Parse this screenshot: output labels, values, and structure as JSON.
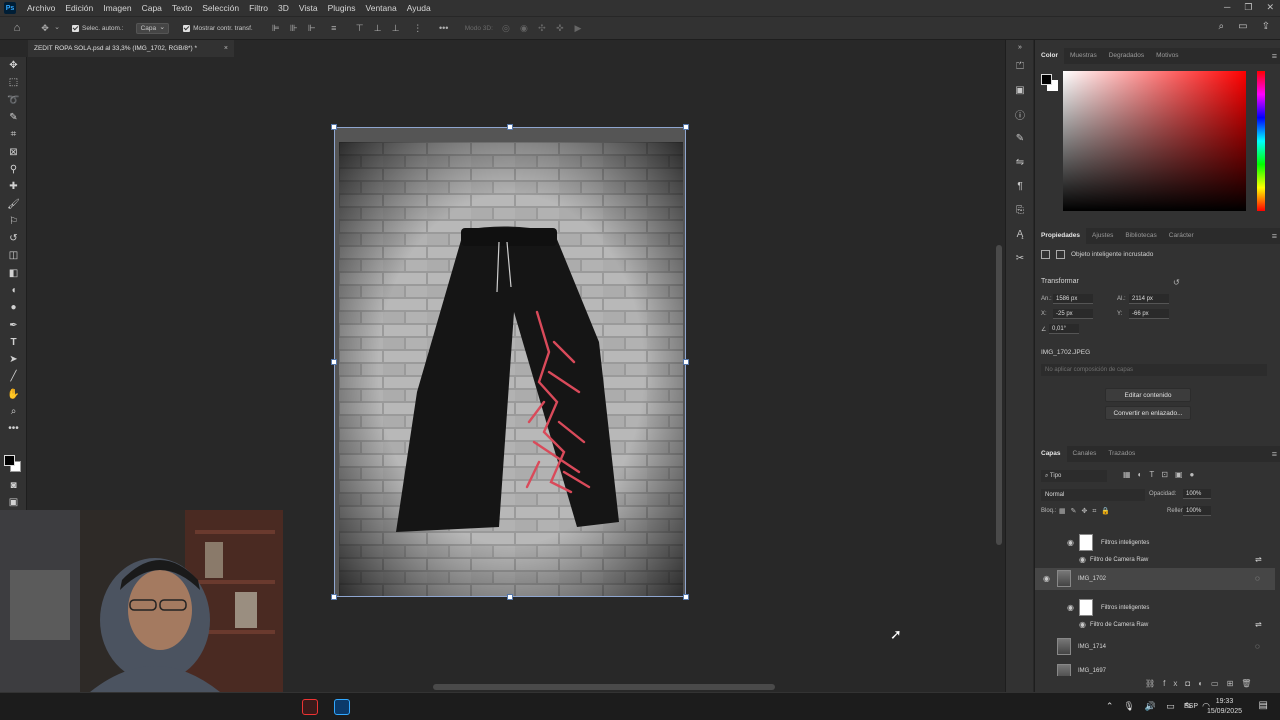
{
  "menu": [
    "Archivo",
    "Edición",
    "Imagen",
    "Capa",
    "Texto",
    "Selección",
    "Filtro",
    "3D",
    "Vista",
    "Plugins",
    "Ventana",
    "Ayuda"
  ],
  "app_logo": "Ps",
  "options": {
    "auto_select_label": "Selec. autom.:",
    "auto_select_value": "Capa",
    "show_transform_label": "Mostrar contr. transf.",
    "mode_3d_label": "Modo 3D:"
  },
  "document_tab": {
    "title": "ZEDIT ROPA SOLA.psd al 33,3% (IMG_1702, RGB/8*) *",
    "close": "×"
  },
  "color_panel": {
    "tabs": [
      "Color",
      "Muestras",
      "Degradados",
      "Motivos"
    ]
  },
  "properties_panel": {
    "tabs": [
      "Propiedades",
      "Ajustes",
      "Bibliotecas",
      "Carácter"
    ],
    "object_type": "Objeto inteligente incrustado",
    "transform_heading": "Transformar",
    "w_label": "An.:",
    "w_value": "1586 px",
    "h_label": "Al.:",
    "h_value": "2114 px",
    "x_label": "X:",
    "x_value": "-25 px",
    "y_label": "Y:",
    "y_value": "-66 px",
    "angle_value": "0,01°",
    "source_name": "IMG_1702.JPEG",
    "comp_placeholder": "No aplicar composición de capas",
    "edit_button": "Editar contenido",
    "convert_button": "Convertir en enlazado..."
  },
  "layers_panel": {
    "tabs": [
      "Capas",
      "Canales",
      "Trazados"
    ],
    "filter_kind": "Tipo",
    "blend_mode": "Normal",
    "opacity_label": "Opacidad:",
    "opacity_value": "100%",
    "lock_label": "Bloq.:",
    "fill_label": "Relleno:",
    "fill_value": "100%",
    "rows": {
      "smart_filters_1": "Filtros inteligentes",
      "camera_raw_1": "Filtro de Camera Raw",
      "layer_1702": "IMG_1702",
      "smart_filters_2": "Filtros inteligentes",
      "camera_raw_2": "Filtro de Camera Raw",
      "layer_1714": "IMG_1714",
      "layer_1697": "IMG_1697"
    }
  },
  "taskbar": {
    "lang": "ESP",
    "time": "19:33",
    "date": "15/09/2025"
  },
  "colors": {
    "accent_handle": "#8fa6d0",
    "print_red": "#d94a5a",
    "pants": "#1a1a1a"
  }
}
